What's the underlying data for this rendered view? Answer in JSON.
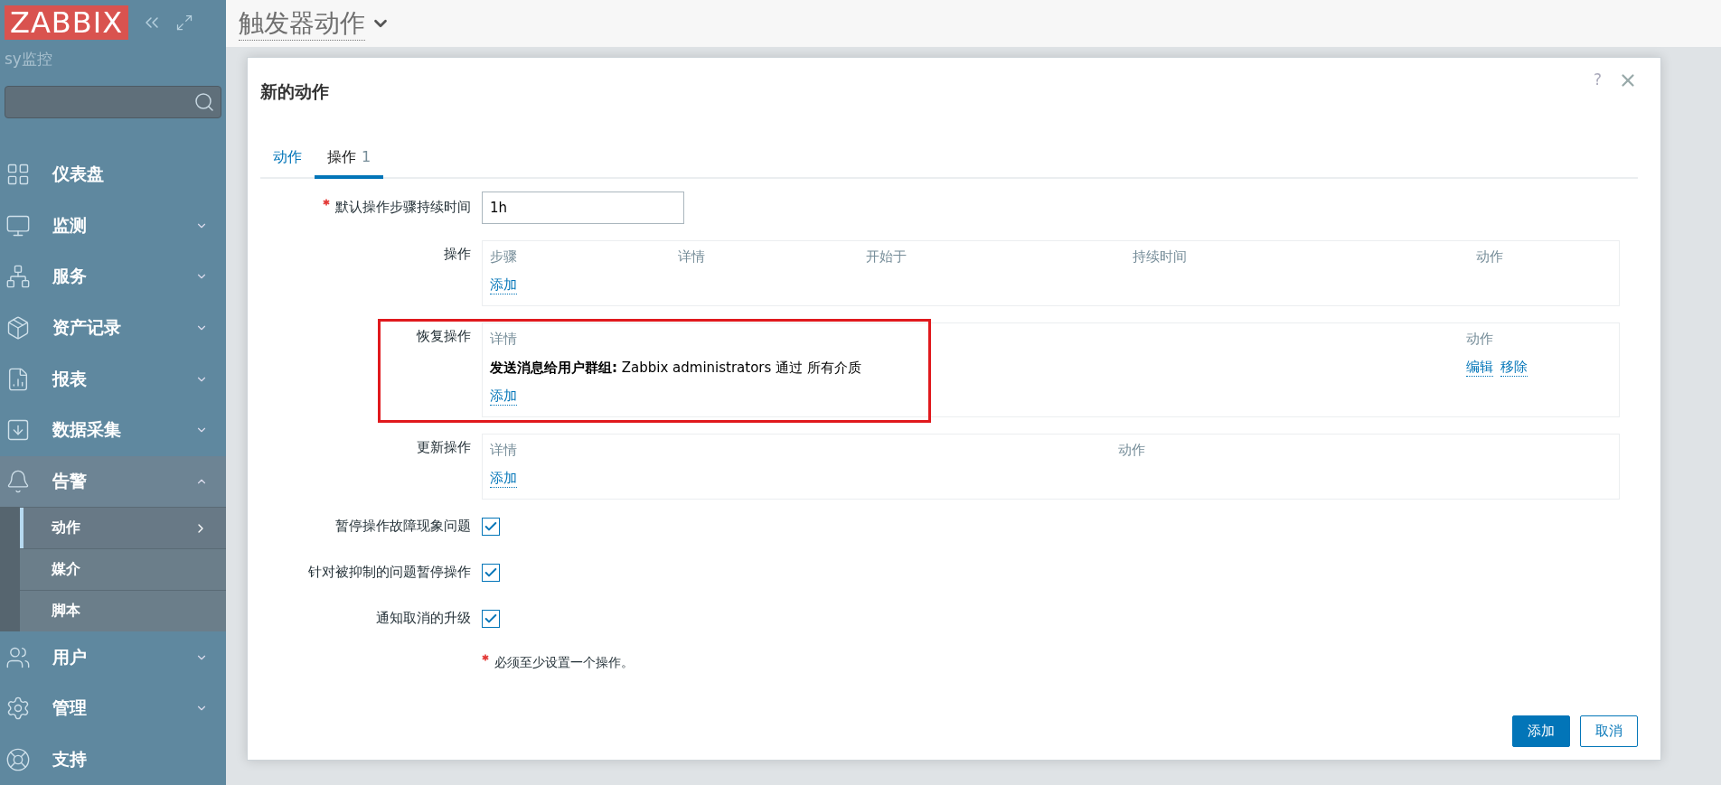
{
  "sidebar": {
    "logo": "ZABBIX",
    "server_name": "sy监控",
    "items": [
      {
        "label": "仪表盘",
        "expanded": false,
        "has_children": false
      },
      {
        "label": "监测",
        "expanded": false,
        "has_children": true
      },
      {
        "label": "服务",
        "expanded": false,
        "has_children": true
      },
      {
        "label": "资产记录",
        "expanded": false,
        "has_children": true
      },
      {
        "label": "报表",
        "expanded": false,
        "has_children": true
      },
      {
        "label": "数据采集",
        "expanded": false,
        "has_children": true
      },
      {
        "label": "告警",
        "expanded": true,
        "has_children": true,
        "children": [
          {
            "label": "动作",
            "selected": true
          },
          {
            "label": "媒介",
            "selected": false
          },
          {
            "label": "脚本",
            "selected": false
          }
        ]
      },
      {
        "label": "用户",
        "expanded": false,
        "has_children": true
      },
      {
        "label": "管理",
        "expanded": false,
        "has_children": true
      },
      {
        "label": "支持",
        "expanded": false,
        "has_children": false
      }
    ]
  },
  "page": {
    "title": "触发器动作"
  },
  "dialog": {
    "title": "新的动作",
    "help": "?",
    "tabs": [
      {
        "label": "动作",
        "selected": false
      },
      {
        "label": "操作",
        "count": "1",
        "selected": true
      }
    ],
    "duration": {
      "label": "默认操作步骤持续时间",
      "required": true,
      "value": "1h"
    },
    "operations": {
      "label": "操作",
      "columns": [
        "步骤",
        "详情",
        "开始于",
        "持续时间",
        "动作"
      ],
      "add": "添加"
    },
    "recovery": {
      "label": "恢复操作",
      "highlighted": true,
      "columns": [
        "详情",
        "动作"
      ],
      "rows": [
        {
          "bold": "发送消息给用户群组:",
          "text": "Zabbix administrators 通过 所有介质",
          "actions": [
            "编辑",
            "移除"
          ]
        }
      ],
      "add": "添加"
    },
    "update": {
      "label": "更新操作",
      "columns": [
        "详情",
        "动作"
      ],
      "add": "添加"
    },
    "checkboxes": [
      {
        "label": "暂停操作故障现象问题",
        "checked": true
      },
      {
        "label": "针对被抑制的问题暂停操作",
        "checked": true
      },
      {
        "label": "通知取消的升级",
        "checked": true
      }
    ],
    "required_note": "必须至少设置一个操作。",
    "buttons": [
      {
        "label": "添加",
        "kind": "primary"
      },
      {
        "label": "取消",
        "kind": "secondary"
      }
    ]
  }
}
